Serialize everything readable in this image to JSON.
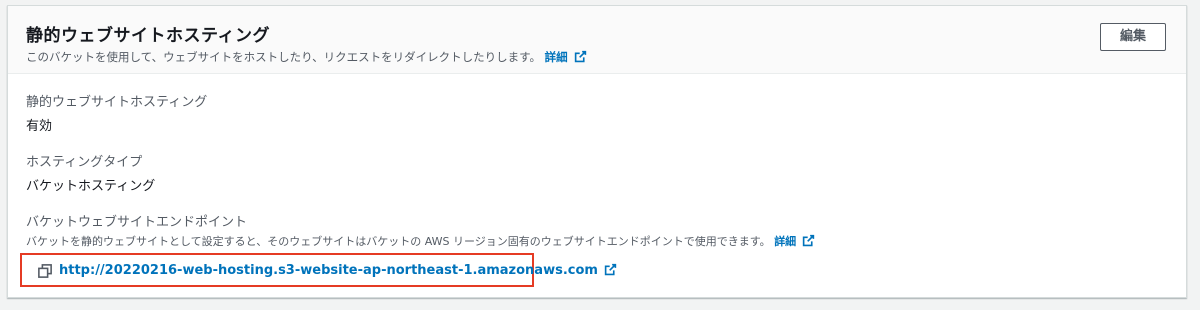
{
  "header": {
    "title": "静的ウェブサイトホスティング",
    "description": "このバケットを使用して、ウェブサイトをホストしたり、リクエストをリダイレクトしたりします。",
    "info_link": "詳細",
    "edit_label": "編集"
  },
  "fields": {
    "hosting": {
      "label": "静的ウェブサイトホスティング",
      "value": "有効"
    },
    "hosting_type": {
      "label": "ホスティングタイプ",
      "value": "バケットホスティング"
    },
    "endpoint": {
      "label": "バケットウェブサイトエンドポイント",
      "description": "バケットを静的ウェブサイトとして設定すると、そのウェブサイトはバケットの AWS リージョン固有のウェブサイトエンドポイントで使用できます。",
      "info_link": "詳細",
      "url": "http://20220216-web-hosting.s3-website-ap-northeast-1.amazonaws.com"
    }
  },
  "colors": {
    "link": "#0073bb",
    "highlight": "#e53b24"
  },
  "icons": [
    "external-link-icon",
    "copy-icon"
  ]
}
